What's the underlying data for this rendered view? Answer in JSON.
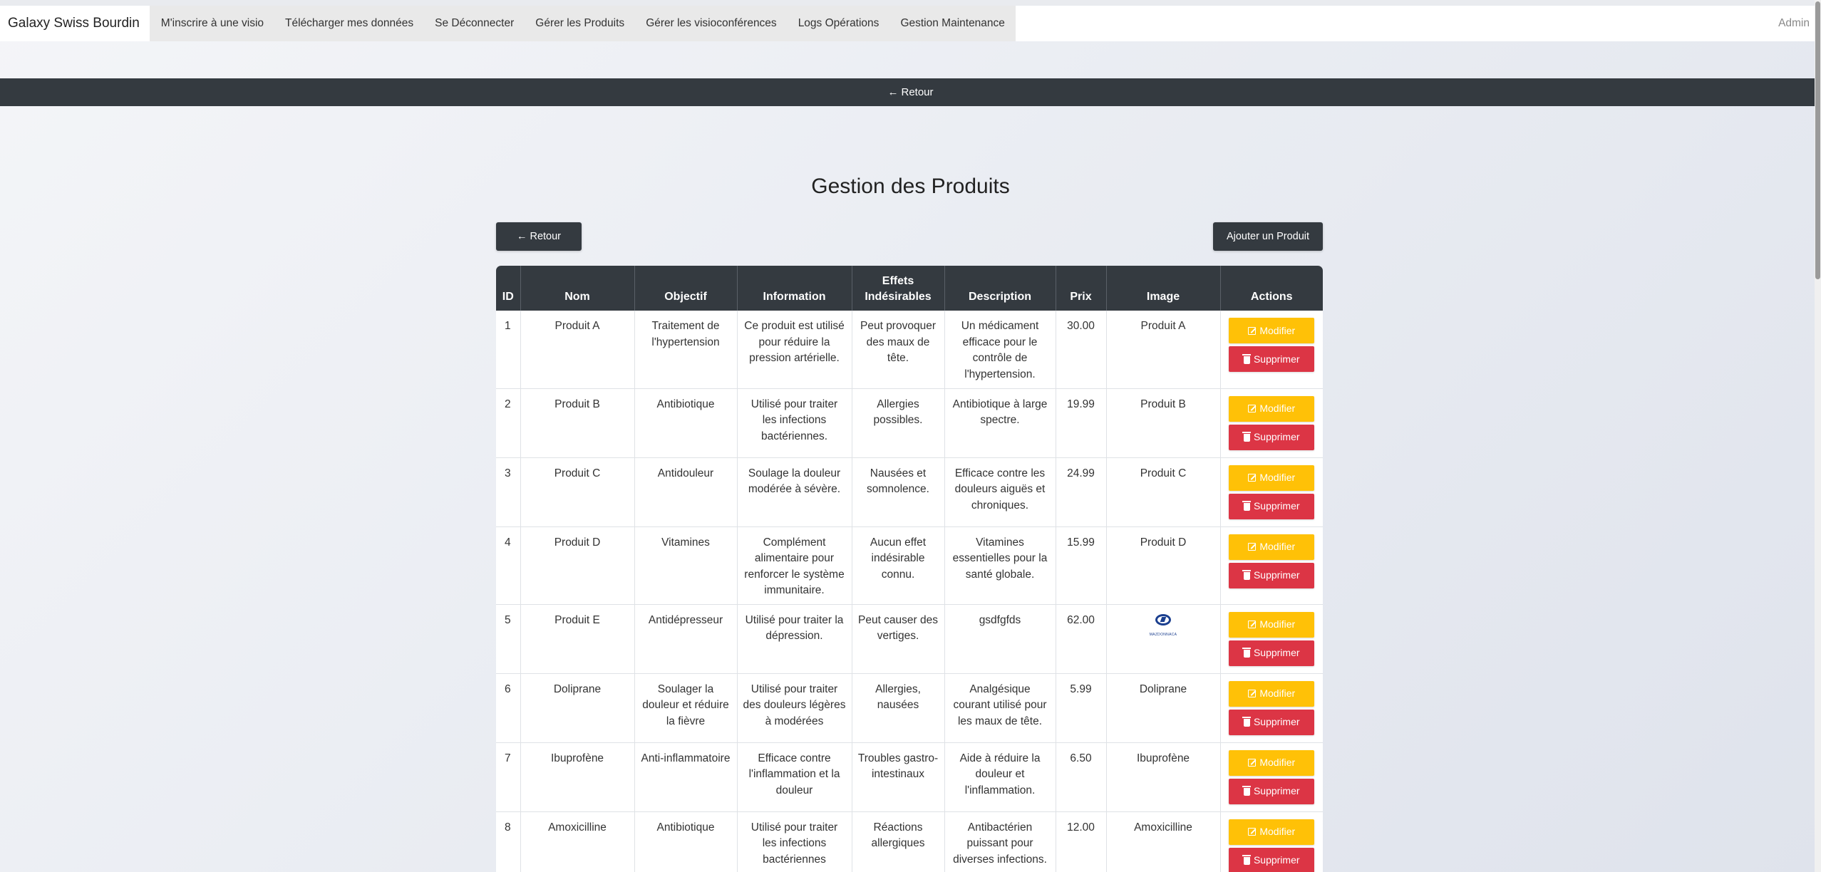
{
  "navbar": {
    "brand": "Galaxy Swiss Bourdin",
    "links": [
      "M'inscrire à une visio",
      "Télécharger mes données",
      "Se Déconnecter",
      "Gérer les Produits",
      "Gérer les visioconférences",
      "Logs Opérations",
      "Gestion Maintenance"
    ],
    "user": "Admin"
  },
  "backbar": {
    "label": "Retour"
  },
  "page": {
    "title": "Gestion des Produits",
    "back_label": "Retour",
    "add_label": "Ajouter un Produit"
  },
  "table": {
    "headers": {
      "id": "ID",
      "nom": "Nom",
      "objectif": "Objectif",
      "information": "Information",
      "effets_1": "Effets",
      "effets_2": "Indésirables",
      "description": "Description",
      "prix": "Prix",
      "image": "Image",
      "actions": "Actions"
    },
    "modify_label": "Modifier",
    "delete_label": "Supprimer",
    "rows": [
      {
        "id": "1",
        "nom": "Produit A",
        "objectif": "Traitement de l'hypertension",
        "information": "Ce produit est utilisé pour réduire la pression artérielle.",
        "effets": "Peut provoquer des maux de tête.",
        "description": "Un médicament efficace pour le contrôle de l'hypertension.",
        "prix": "30.00",
        "image": "Produit A"
      },
      {
        "id": "2",
        "nom": "Produit B",
        "objectif": "Antibiotique",
        "information": "Utilisé pour traiter les infections bactériennes.",
        "effets": "Allergies possibles.",
        "description": "Antibiotique à large spectre.",
        "prix": "19.99",
        "image": "Produit B"
      },
      {
        "id": "3",
        "nom": "Produit C",
        "objectif": "Antidouleur",
        "information": "Soulage la douleur modérée à sévère.",
        "effets": "Nausées et somnolence.",
        "description": "Efficace contre les douleurs aiguës et chroniques.",
        "prix": "24.99",
        "image": "Produit C"
      },
      {
        "id": "4",
        "nom": "Produit D",
        "objectif": "Vitamines",
        "information": "Complément alimentaire pour renforcer le système immunitaire.",
        "effets": "Aucun effet indésirable connu.",
        "description": "Vitamines essentielles pour la santé globale.",
        "prix": "15.99",
        "image": "Produit D"
      },
      {
        "id": "5",
        "nom": "Produit E",
        "objectif": "Antidépresseur",
        "information": "Utilisé pour traiter la dépression.",
        "effets": "Peut causer des vertiges.",
        "description": "gsdfgfds",
        "prix": "62.00",
        "image": "MAZDONNACA"
      },
      {
        "id": "6",
        "nom": "Doliprane",
        "objectif": "Soulager la douleur et réduire la fièvre",
        "information": "Utilisé pour traiter des douleurs légères à modérées",
        "effets": "Allergies, nausées",
        "description": "Analgésique courant utilisé pour les maux de tête.",
        "prix": "5.99",
        "image": "Doliprane"
      },
      {
        "id": "7",
        "nom": "Ibuprofène",
        "objectif": "Anti-inflammatoire",
        "information": "Efficace contre l'inflammation et la douleur",
        "effets": "Troubles gastro-intestinaux",
        "description": "Aide à réduire la douleur et l'inflammation.",
        "prix": "6.50",
        "image": "Ibuprofène"
      },
      {
        "id": "8",
        "nom": "Amoxicilline",
        "objectif": "Antibiotique",
        "information": "Utilisé pour traiter les infections bactériennes",
        "effets": "Réactions allergiques",
        "description": "Antibactérien puissant pour diverses infections.",
        "prix": "12.00",
        "image": "Amoxicilline"
      }
    ]
  }
}
